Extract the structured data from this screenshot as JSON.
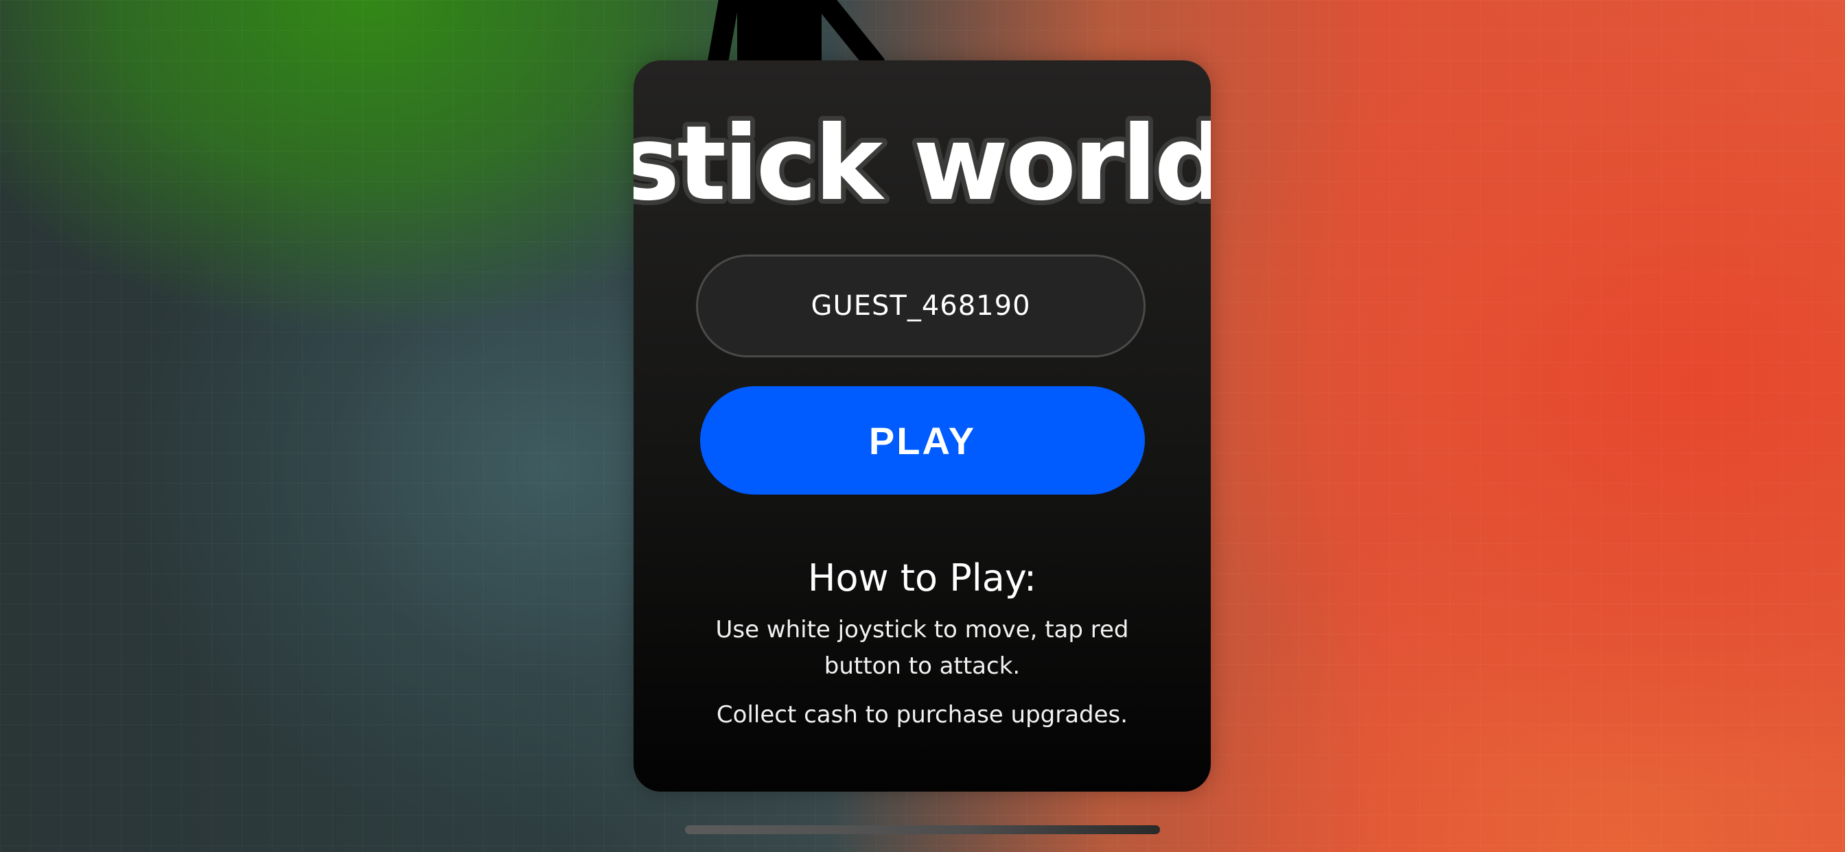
{
  "game": {
    "logo_text": "stick world"
  },
  "login": {
    "username_value": "GUEST_468190",
    "play_label": "PLAY"
  },
  "instructions": {
    "title": "How to Play:",
    "line_1": "Use white joystick to move, tap red button to attack.",
    "line_2": "Collect cash to purchase upgrades."
  },
  "colors": {
    "play_button": "#005cff",
    "card_background": "#141413",
    "background_green": "#328c14",
    "background_red": "#e2483a"
  },
  "icons": {
    "character": "stickman-figure"
  }
}
